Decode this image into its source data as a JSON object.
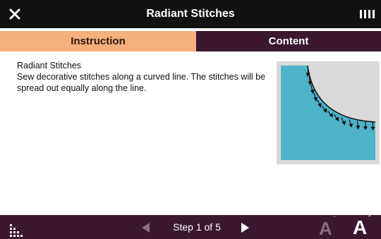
{
  "titlebar": {
    "title": "Radiant Stitches",
    "close_icon": "close-icon",
    "status_icon": "signal-bars-icon"
  },
  "tabs": [
    {
      "label": "Instruction",
      "active": true
    },
    {
      "label": "Content",
      "active": false
    }
  ],
  "main": {
    "heading": "Radiant Stitches",
    "body": "Sew decorative stitches along a curved line. The stitches will be spread out equally along the line.",
    "figure_icon": "radiant-stitches-illustration"
  },
  "bottombar": {
    "menu_icon": "grid-menu-icon",
    "step_text": "Step 1 of 5",
    "prev_icon": "prev-arrow-icon",
    "next_icon": "next-arrow-icon",
    "font_decrease": {
      "label": "A",
      "mark": "ˇ"
    },
    "font_increase": {
      "label": "A",
      "mark": "ˆ"
    }
  },
  "colors": {
    "titlebar_bg": "#111111",
    "active_tab": "#f5b07b",
    "inactive_tab": "#3b1730",
    "bottombar_bg": "#3b1730",
    "figure_fill": "#4db3c9",
    "figure_bg": "#d9d9d9"
  }
}
